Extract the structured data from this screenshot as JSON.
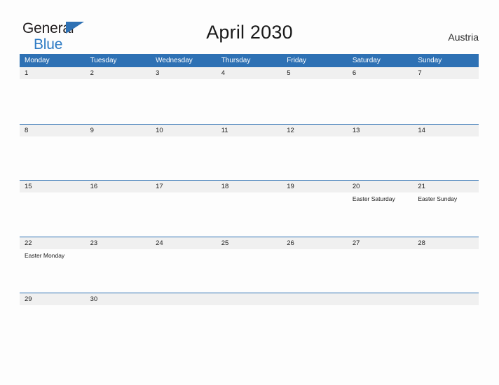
{
  "logo": {
    "word1": "General",
    "word2": "Blue",
    "triangle_color": "#2E71B4",
    "word1_color": "#231F20",
    "word2_color": "#2E7BC4"
  },
  "header": {
    "title": "April 2030",
    "region": "Austria"
  },
  "theme": {
    "accent": "#2E71B4",
    "band": "#F0F0F0",
    "page_bg": "#FDFDFD",
    "header_text": "#FFFFFF"
  },
  "calendar": {
    "month": "April",
    "year": "2030",
    "weekdays": [
      "Monday",
      "Tuesday",
      "Wednesday",
      "Thursday",
      "Friday",
      "Saturday",
      "Sunday"
    ],
    "weeks": [
      [
        {
          "day": "1",
          "event": ""
        },
        {
          "day": "2",
          "event": ""
        },
        {
          "day": "3",
          "event": ""
        },
        {
          "day": "4",
          "event": ""
        },
        {
          "day": "5",
          "event": ""
        },
        {
          "day": "6",
          "event": ""
        },
        {
          "day": "7",
          "event": ""
        }
      ],
      [
        {
          "day": "8",
          "event": ""
        },
        {
          "day": "9",
          "event": ""
        },
        {
          "day": "10",
          "event": ""
        },
        {
          "day": "11",
          "event": ""
        },
        {
          "day": "12",
          "event": ""
        },
        {
          "day": "13",
          "event": ""
        },
        {
          "day": "14",
          "event": ""
        }
      ],
      [
        {
          "day": "15",
          "event": ""
        },
        {
          "day": "16",
          "event": ""
        },
        {
          "day": "17",
          "event": ""
        },
        {
          "day": "18",
          "event": ""
        },
        {
          "day": "19",
          "event": ""
        },
        {
          "day": "20",
          "event": "Easter Saturday"
        },
        {
          "day": "21",
          "event": "Easter Sunday"
        }
      ],
      [
        {
          "day": "22",
          "event": "Easter Monday"
        },
        {
          "day": "23",
          "event": ""
        },
        {
          "day": "24",
          "event": ""
        },
        {
          "day": "25",
          "event": ""
        },
        {
          "day": "26",
          "event": ""
        },
        {
          "day": "27",
          "event": ""
        },
        {
          "day": "28",
          "event": ""
        }
      ],
      [
        {
          "day": "29",
          "event": ""
        },
        {
          "day": "30",
          "event": ""
        },
        {
          "day": "",
          "event": ""
        },
        {
          "day": "",
          "event": ""
        },
        {
          "day": "",
          "event": ""
        },
        {
          "day": "",
          "event": ""
        },
        {
          "day": "",
          "event": ""
        }
      ]
    ]
  }
}
